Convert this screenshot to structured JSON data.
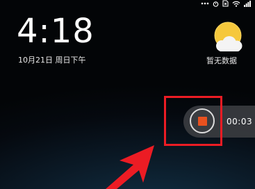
{
  "status_bar": {
    "icons": [
      "more-icon",
      "alarm-icon",
      "sim-card-icon",
      "wifi-icon",
      "signal-icon"
    ]
  },
  "lock_screen": {
    "time": "4:18",
    "date": "10月21日 周日下午"
  },
  "weather": {
    "icon": "weather-sun-cloud-icon",
    "label": "暂无数据"
  },
  "screen_recorder": {
    "stop_icon": "stop-icon",
    "elapsed": "00:03"
  },
  "annotation": {
    "box_color": "#ec1c24",
    "arrow_color": "#ec1c24"
  },
  "colors": {
    "stop_square": "#e8511f",
    "recorder_bg": "#3a3c40"
  }
}
